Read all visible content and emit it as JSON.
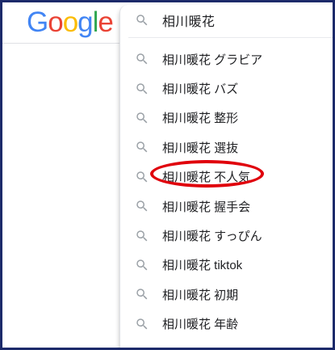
{
  "logo": {
    "letters": [
      "G",
      "o",
      "o",
      "g",
      "l",
      "e"
    ],
    "colors": [
      "#4285F4",
      "#EA4335",
      "#FBBC05",
      "#4285F4",
      "#34A853",
      "#EA4335"
    ]
  },
  "search": {
    "query": "相川暖花",
    "icon": "search-icon"
  },
  "suggestions": [
    "相川暖花 グラビア",
    "相川暖花 バズ",
    "相川暖花 整形",
    "相川暖花 選抜",
    "相川暖花 不人気",
    "相川暖花 握手会",
    "相川暖花 すっぴん",
    "相川暖花 tiktok",
    "相川暖花 初期",
    "相川暖花 年齢"
  ],
  "highlight": {
    "suggestion": "相川暖花 不人気",
    "color": "#E0000B"
  },
  "colors": {
    "frame_border": "#1C2A6A",
    "text": "#202124",
    "icon": "#9AA0A6"
  }
}
